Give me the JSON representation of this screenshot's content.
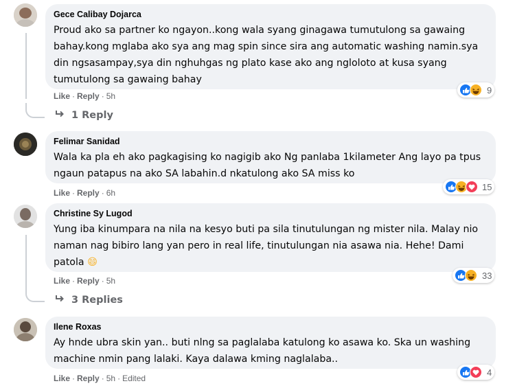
{
  "actions": {
    "like": "Like",
    "reply": "Reply",
    "separator": "·"
  },
  "comments": [
    {
      "author": "Gece Calibay Dojarca",
      "text": "Proud ako sa partner ko ngayon..kong wala syang ginagawa tumutulong sa gawaing bahay.kong mglaba ako sya ang mag spin since sira ang automatic washing namin.sya din ngsasampay,sya din nghuhgas ng plato kase ako ang ngloloto at kusa syang tumutulong sa gawaing bahay",
      "time": "5h",
      "reaction_count": "9",
      "reaction_icons": [
        "like-icon",
        "haha-icon"
      ]
    },
    {
      "author": "Felimar Sanidad",
      "text": "Wala ka pla eh ako pagkagising ko nagigib ako Ng panlaba 1kilameter Ang layo pa tpus ngaun patapus na ako SA labahin.d nkatulong ako SA miss ko",
      "time": "6h",
      "reaction_count": "15",
      "reaction_icons": [
        "like-icon",
        "haha-icon",
        "love-icon"
      ]
    },
    {
      "author": "Christine Sy Lugod",
      "text": "Yung iba kinumpara na nila na kesyo buti pa sila tinutulungan ng mister nila. Malay nio naman nag bibiro lang yan pero in real life, tinutulungan nia asawa nia. Hehe! Dami patola",
      "emoji": "😄",
      "time": "5h",
      "reaction_count": "33",
      "reaction_icons": [
        "like-icon",
        "haha-icon"
      ]
    },
    {
      "author": "Ilene Roxas",
      "text": "Ay hnde ubra skin yan.. buti nlng sa paglalaba katulong ko asawa ko. Ska un washing machine nmin pang lalaki. Kaya dalawa kming naglalaba..",
      "time": "5h",
      "edited": "Edited",
      "reaction_count": "4",
      "reaction_icons": [
        "like-icon",
        "love-icon"
      ]
    }
  ],
  "reply_threads": [
    {
      "label": "1 Reply"
    },
    {
      "label": "3 Replies"
    }
  ],
  "colors": {
    "bubble": "#f0f2f5",
    "secondary_text": "#65676b",
    "like_blue": "#1877f2",
    "haha_yellow": "#f7b125",
    "love_red": "#f33e58"
  }
}
